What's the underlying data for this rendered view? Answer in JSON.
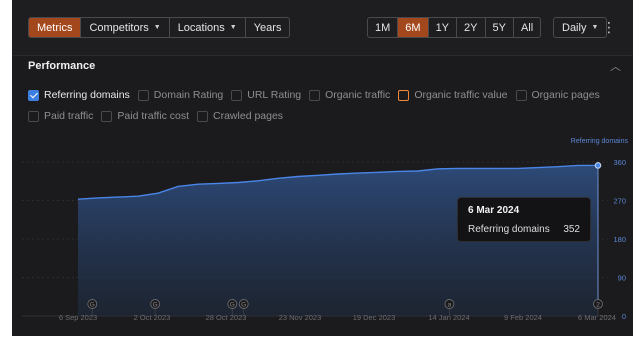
{
  "tabs": [
    {
      "label": "Metrics",
      "active": true,
      "dropdown": false
    },
    {
      "label": "Competitors",
      "active": false,
      "dropdown": true
    },
    {
      "label": "Locations",
      "active": false,
      "dropdown": true
    },
    {
      "label": "Years",
      "active": false,
      "dropdown": false
    }
  ],
  "ranges": [
    {
      "label": "1M",
      "active": false
    },
    {
      "label": "6M",
      "active": true
    },
    {
      "label": "1Y",
      "active": false
    },
    {
      "label": "2Y",
      "active": false
    },
    {
      "label": "5Y",
      "active": false
    },
    {
      "label": "All",
      "active": false
    }
  ],
  "interval": {
    "label": "Daily",
    "icon": "chevron-down-icon"
  },
  "more_icon": "kebab-menu-icon",
  "section": {
    "title": "Performance",
    "collapse_icon": "chevron-up-icon"
  },
  "metrics_row1": [
    {
      "label": "Referring domains",
      "checked": true,
      "accent": ""
    },
    {
      "label": "Domain Rating",
      "checked": false,
      "accent": ""
    },
    {
      "label": "URL Rating",
      "checked": false,
      "accent": ""
    },
    {
      "label": "Organic traffic",
      "checked": false,
      "accent": ""
    },
    {
      "label": "Organic traffic value",
      "checked": false,
      "accent": "#f0883e"
    },
    {
      "label": "Organic pages",
      "checked": false,
      "accent": ""
    }
  ],
  "metrics_row2": [
    {
      "label": "Paid traffic",
      "checked": false,
      "accent": ""
    },
    {
      "label": "Paid traffic cost",
      "checked": false,
      "accent": ""
    },
    {
      "label": "Crawled pages",
      "checked": false,
      "accent": ""
    }
  ],
  "tooltip": {
    "date": "6 Mar 2024",
    "metric": "Referring domains",
    "value": "352"
  },
  "colors": {
    "accent_orange": "#a3471c",
    "series_blue": "#4a85e8",
    "checkbox_blue": "#3d7fe0"
  },
  "chart_data": {
    "type": "area",
    "series": [
      {
        "name": "Referring domains",
        "color": "#4a85e8"
      }
    ],
    "x": [
      "2023-09-06",
      "2023-09-13",
      "2023-09-20",
      "2023-09-27",
      "2023-10-04",
      "2023-10-11",
      "2023-10-18",
      "2023-10-25",
      "2023-11-01",
      "2023-11-08",
      "2023-11-15",
      "2023-11-22",
      "2023-11-29",
      "2023-12-06",
      "2023-12-13",
      "2023-12-20",
      "2023-12-27",
      "2024-01-03",
      "2024-01-10",
      "2024-01-17",
      "2024-01-24",
      "2024-01-31",
      "2024-02-07",
      "2024-02-14",
      "2024-02-21",
      "2024-02-28",
      "2024-03-06"
    ],
    "y": [
      273,
      276,
      278,
      280,
      287,
      303,
      308,
      310,
      312,
      316,
      322,
      326,
      329,
      332,
      334,
      336,
      338,
      339,
      344,
      345,
      345,
      345,
      345,
      347,
      349,
      352,
      352
    ],
    "x_ticks": [
      "6 Sep 2023",
      "2 Oct 2023",
      "28 Oct 2023",
      "23 Nov 2023",
      "19 Dec 2023",
      "14 Jan 2024",
      "9 Feb 2024",
      "6 Mar 2024"
    ],
    "y_ticks": [
      "0",
      "90",
      "180",
      "270",
      "360"
    ],
    "ylim": [
      0,
      380
    ],
    "annotation_markers": [
      {
        "x": "2023-09-11",
        "label": "G"
      },
      {
        "x": "2023-10-03",
        "label": "G"
      },
      {
        "x": "2023-10-30",
        "label": "G"
      },
      {
        "x": "2023-11-03",
        "label": "G"
      },
      {
        "x": "2024-01-14",
        "label": "a"
      },
      {
        "x": "2024-03-06",
        "label": "2"
      }
    ],
    "legend": "top-right",
    "grid": true
  }
}
